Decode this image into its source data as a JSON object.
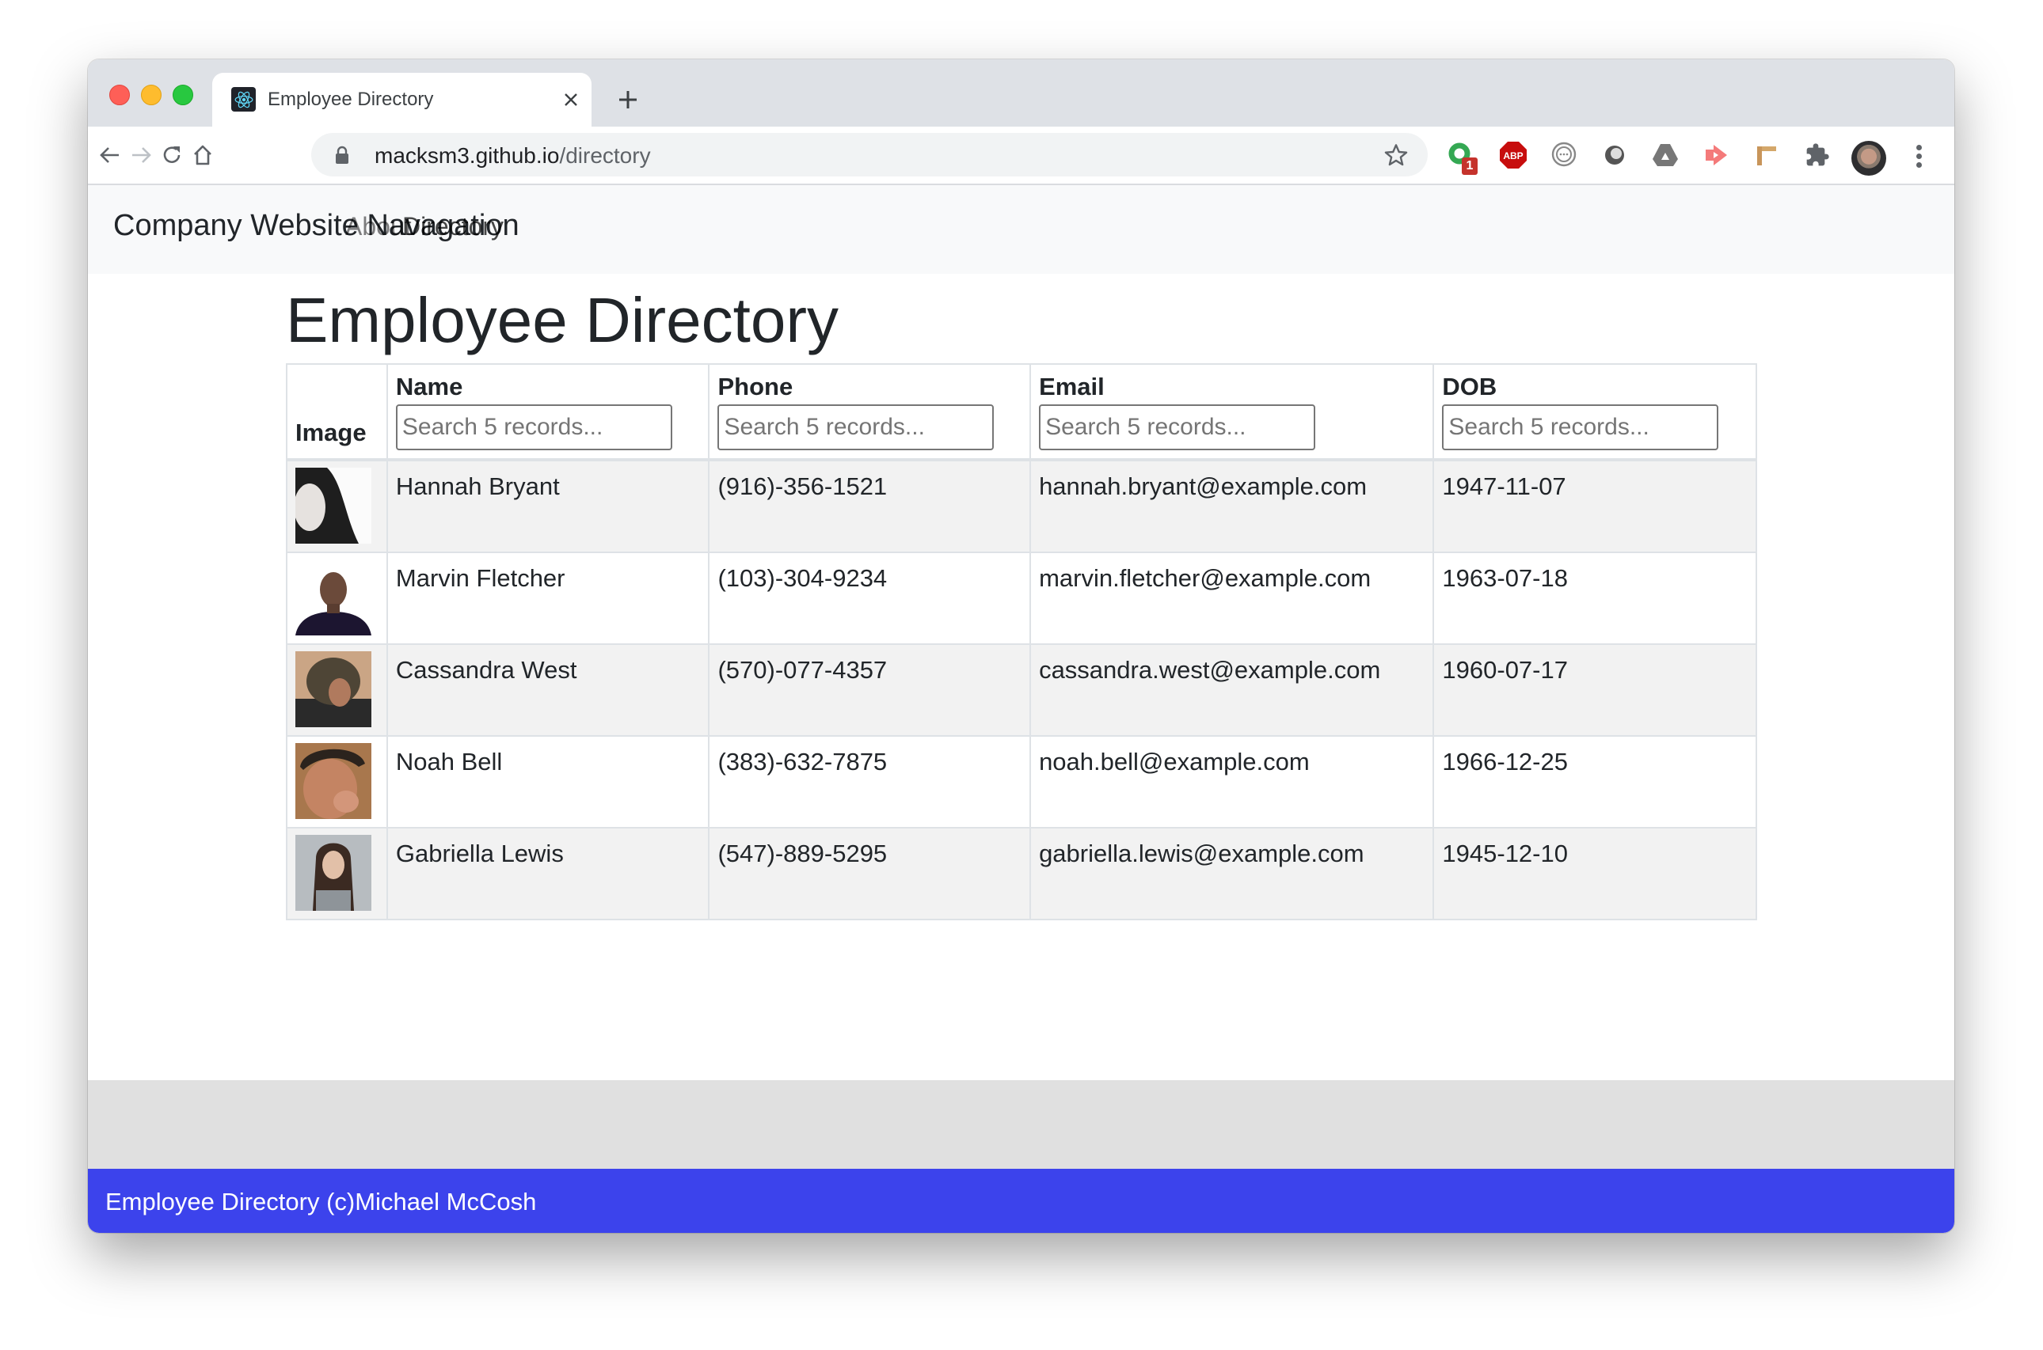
{
  "browser": {
    "tab": {
      "title": "Employee Directory",
      "favicon": "react-logo-icon"
    },
    "address": {
      "host": "macksm3.github.io",
      "path": "/directory"
    },
    "extensions": [
      {
        "name": "green-ring-extension-icon",
        "badge": "1"
      },
      {
        "name": "adblock-plus-icon",
        "label": "ABP"
      },
      {
        "name": "chat-bubble-extension-icon"
      },
      {
        "name": "grey-circle-extension-icon"
      },
      {
        "name": "google-drive-icon"
      },
      {
        "name": "red-arrow-extension-icon"
      },
      {
        "name": "ruler-extension-icon"
      },
      {
        "name": "extensions-puzzle-icon"
      }
    ],
    "colors": {
      "tabstrip": "#dee1e6",
      "omnibox": "#f1f3f4"
    }
  },
  "navbar": {
    "brand": "Company Website Navagation",
    "links": [
      {
        "label": "About"
      },
      {
        "label": "Directory"
      }
    ]
  },
  "main": {
    "title": "Employee Directory",
    "table": {
      "columns": [
        {
          "label": "Image"
        },
        {
          "label": "Name",
          "placeholder": "Search 5 records..."
        },
        {
          "label": "Phone",
          "placeholder": "Search 5 records..."
        },
        {
          "label": "Email",
          "placeholder": "Search 5 records..."
        },
        {
          "label": "DOB",
          "placeholder": "Search 5 records..."
        }
      ],
      "rows": [
        {
          "photo": "hannah-bryant-photo",
          "name": "Hannah Bryant",
          "phone": "(916)-356-1521",
          "email": "hannah.bryant@example.com",
          "dob": "1947-11-07"
        },
        {
          "photo": "marvin-fletcher-photo",
          "name": "Marvin Fletcher",
          "phone": "(103)-304-9234",
          "email": "marvin.fletcher@example.com",
          "dob": "1963-07-18"
        },
        {
          "photo": "cassandra-west-photo",
          "name": "Cassandra West",
          "phone": "(570)-077-4357",
          "email": "cassandra.west@example.com",
          "dob": "1960-07-17"
        },
        {
          "photo": "noah-bell-photo",
          "name": "Noah Bell",
          "phone": "(383)-632-7875",
          "email": "noah.bell@example.com",
          "dob": "1966-12-25"
        },
        {
          "photo": "gabriella-lewis-photo",
          "name": "Gabriella Lewis",
          "phone": "(547)-889-5295",
          "email": "gabriella.lewis@example.com",
          "dob": "1945-12-10"
        }
      ]
    }
  },
  "footer": {
    "text": "Employee Directory (c)Michael McCosh",
    "color": "#3c43ec"
  }
}
